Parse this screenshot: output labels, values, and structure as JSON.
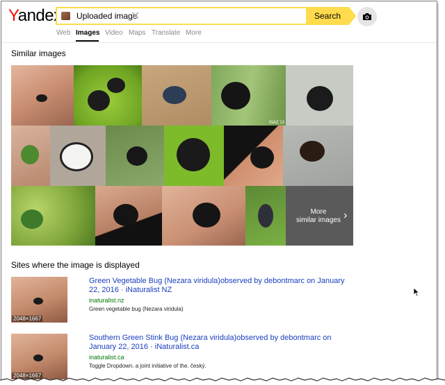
{
  "header": {
    "logo": {
      "first_letter": "Y",
      "rest": "andex"
    },
    "search": {
      "uploaded_label": "Uploaded image",
      "button_label": "Search"
    },
    "tabs": [
      {
        "label": "Web",
        "active": false
      },
      {
        "label": "Images",
        "active": true
      },
      {
        "label": "Video",
        "active": false
      },
      {
        "label": "Maps",
        "active": false
      },
      {
        "label": "Translate",
        "active": false
      },
      {
        "label": "More",
        "active": false
      }
    ]
  },
  "similar": {
    "title": "Similar images",
    "tile_watermark": "INAZ 13",
    "more_label": "More\nsimilar images"
  },
  "sites": {
    "title": "Sites where the image is displayed",
    "results": [
      {
        "title": "Green Vegetable Bug (Nezara viridula)observed by debontmarc on January 22, 2016 · iNaturalist NZ",
        "url": "inaturalist.nz",
        "description": "Green vegetable bug (Nezara viridula)",
        "thumb_size": "2048×1667"
      },
      {
        "title": "Southern Green Stink Bug (Nezara viridula)observed by debontmarc on January 22, 2016 · iNaturalist.ca",
        "url": "inaturalist.ca",
        "description": "Toggle Dropdown. a joint initiative of the. český.",
        "thumb_size": "2048×1667"
      }
    ]
  },
  "colors": {
    "accent": "#ffdb4d",
    "logo_red": "#ff0000",
    "link_blue": "#1a3dbf",
    "url_green": "#007700"
  }
}
